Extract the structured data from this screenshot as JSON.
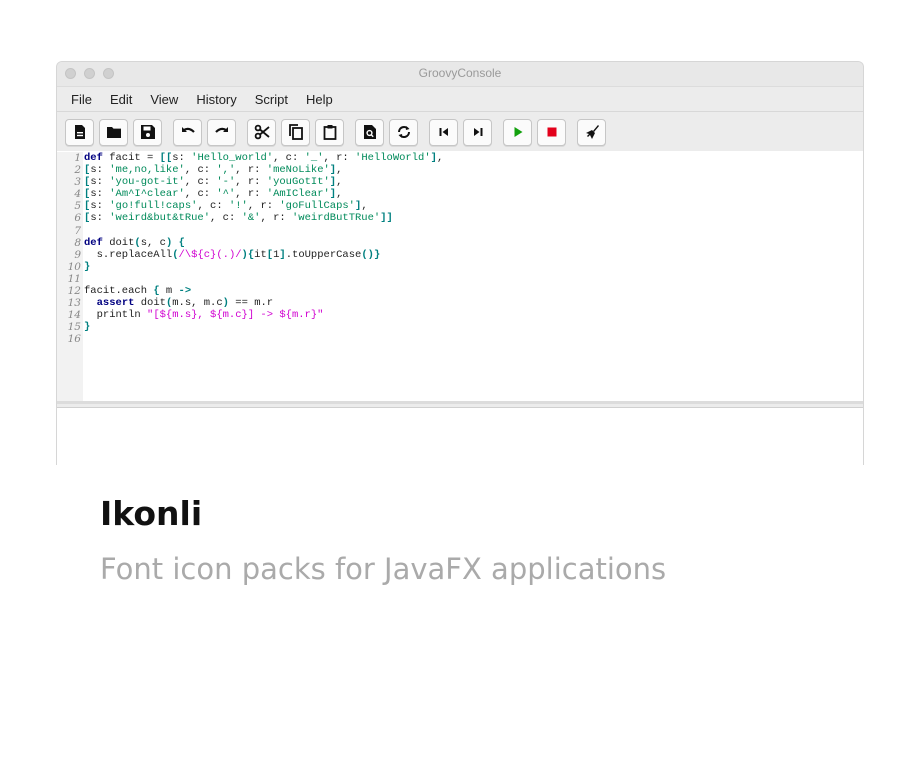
{
  "window": {
    "title": "GroovyConsole"
  },
  "menu": [
    "File",
    "Edit",
    "View",
    "History",
    "Script",
    "Help"
  ],
  "toolbar": {
    "icons": [
      "new-file-icon",
      "open-folder-icon",
      "save-icon",
      "undo-icon",
      "redo-icon",
      "cut-icon",
      "copy-icon",
      "paste-icon",
      "find-icon",
      "replace-icon",
      "previous-history-icon",
      "next-history-icon",
      "run-icon",
      "stop-icon",
      "clear-output-icon"
    ],
    "colors": {
      "run": "#13a10e",
      "stop": "#e3001b"
    }
  },
  "editor": {
    "line_numbers": [
      "1",
      "2",
      "3",
      "4",
      "5",
      "6",
      "7",
      "8",
      "9",
      "10",
      "11",
      "12",
      "13",
      "14",
      "15",
      "16"
    ],
    "lines": [
      "def facit = [[s: 'Hello_world', c: '_', r: 'HelloWorld'],",
      "[s: 'me,no,like', c: ',', r: 'meNoLike'],",
      "[s: 'you-got-it', c: '-', r: 'youGotIt'],",
      "[s: 'Am^I^clear', c: '^', r: 'AmIClear'],",
      "[s: 'go!full!caps', c: '!', r: 'goFullCaps'],",
      "[s: 'weird&but&tRue', c: '&', r: 'weirdButTRue']]",
      "",
      "def doit(s, c) {",
      "  s.replaceAll(/\\${c}(.)/){it[1].toUpperCase()}",
      "}",
      "",
      "facit.each { m ->",
      "  assert doit(m.s, m.c) == m.r",
      "  println \"[${m.s}, ${m.c}] -> ${m.r}\"",
      "}",
      ""
    ]
  },
  "page": {
    "heading": "Ikonli",
    "subtitle": "Font icon packs for JavaFX applications"
  }
}
